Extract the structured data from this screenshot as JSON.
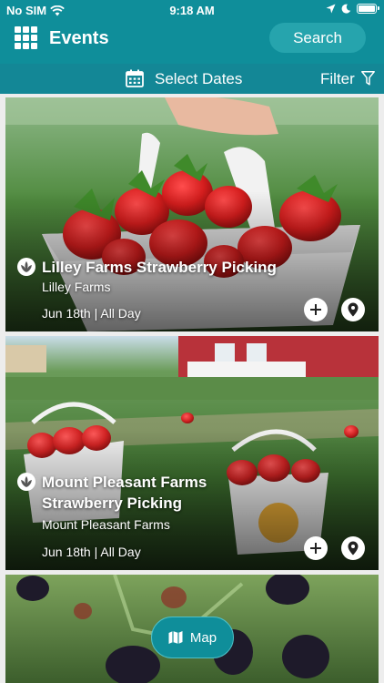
{
  "status_bar": {
    "carrier": "No SIM",
    "time": "9:18 AM"
  },
  "header": {
    "title": "Events",
    "search_label": "Search"
  },
  "subbar": {
    "select_dates_label": "Select Dates",
    "filter_label": "Filter"
  },
  "events": [
    {
      "title": "Lilley Farms Strawberry Picking",
      "venue": "Lilley Farms",
      "date": "Jun 18th | All Day"
    },
    {
      "title": "Mount Pleasant Farms Strawberry Picking",
      "venue": "Mount Pleasant Farms",
      "date": "Jun 18th | All Day"
    },
    {
      "title": "",
      "venue": "",
      "date": ""
    }
  ],
  "map_button": {
    "label": "Map"
  },
  "colors": {
    "brand": "#0f8e9a",
    "subbar": "#138796",
    "search_pill": "#26a4ad"
  }
}
